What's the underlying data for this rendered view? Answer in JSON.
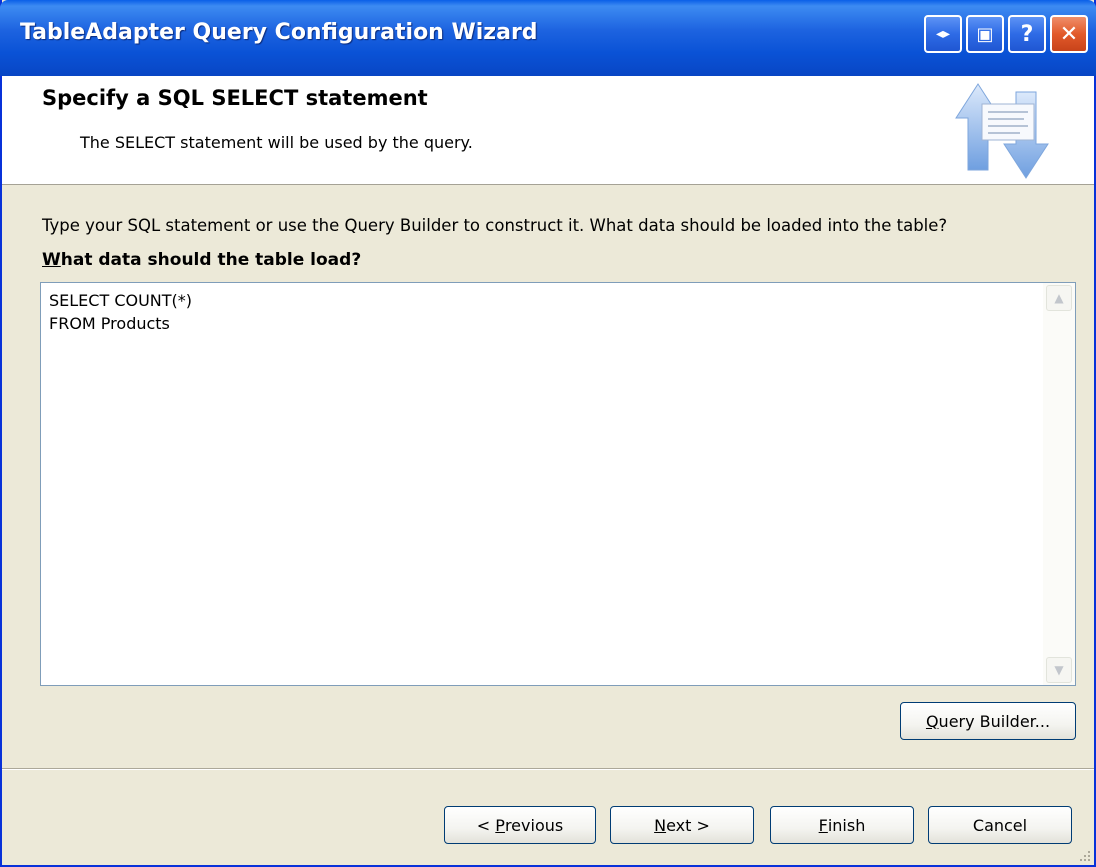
{
  "window": {
    "title": "TableAdapter Query Configuration Wizard",
    "accent_color": "#0a52d6",
    "controls": [
      {
        "name": "resize-icon",
        "glyph": "◂▸"
      },
      {
        "name": "restore-icon",
        "glyph": "▣"
      },
      {
        "name": "help-icon",
        "glyph": "?"
      },
      {
        "name": "close-icon",
        "glyph": "✕"
      }
    ]
  },
  "header": {
    "title": "Specify a SQL SELECT statement",
    "subtitle": "The SELECT statement will be used by the query.",
    "icon": "sql-transfer-icon"
  },
  "body": {
    "instruction": "Type your SQL statement or use the Query Builder to construct it. What data should be loaded into the table?",
    "prompt_label": {
      "mnemonic": "W",
      "rest": "hat data should the table load?"
    },
    "sql_statement": "SELECT COUNT(*)\nFROM Products",
    "query_builder_button": {
      "mnemonic": "Q",
      "rest": "uery Builder..."
    }
  },
  "footer": {
    "previous": {
      "prefix": "< ",
      "mnemonic": "P",
      "rest": "revious"
    },
    "next": {
      "mnemonic": "N",
      "rest": "ext >"
    },
    "finish": {
      "mnemonic": "F",
      "rest": "inish"
    },
    "cancel": "Cancel"
  }
}
